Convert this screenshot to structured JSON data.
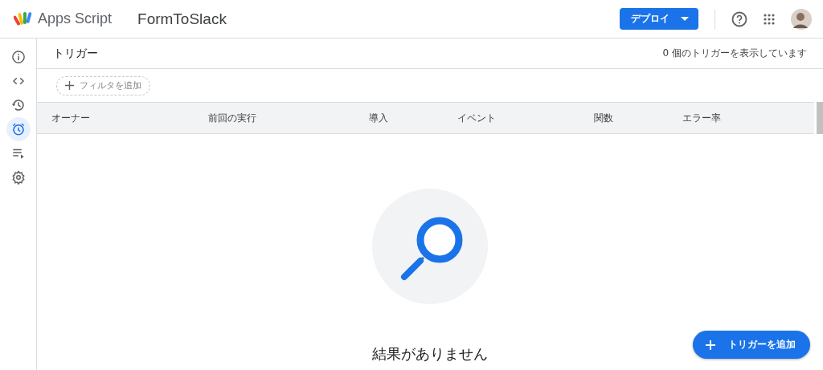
{
  "header": {
    "app_name": "Apps Script",
    "project_title": "FormToSlack",
    "deploy_button": "デプロイ"
  },
  "sidebar": {
    "items": [
      {
        "selected": false
      },
      {
        "selected": false
      },
      {
        "selected": false
      },
      {
        "selected": true
      },
      {
        "selected": false
      },
      {
        "selected": false
      }
    ]
  },
  "page": {
    "title": "トリガー",
    "count_text": "0 個のトリガーを表示しています",
    "filter_button": "フィルタを追加"
  },
  "table": {
    "columns": [
      "オーナー",
      "前回の実行",
      "導入",
      "イベント",
      "関数",
      "エラー率"
    ]
  },
  "empty_state": {
    "message": "結果がありません"
  },
  "fab": {
    "label": "トリガーを追加"
  }
}
